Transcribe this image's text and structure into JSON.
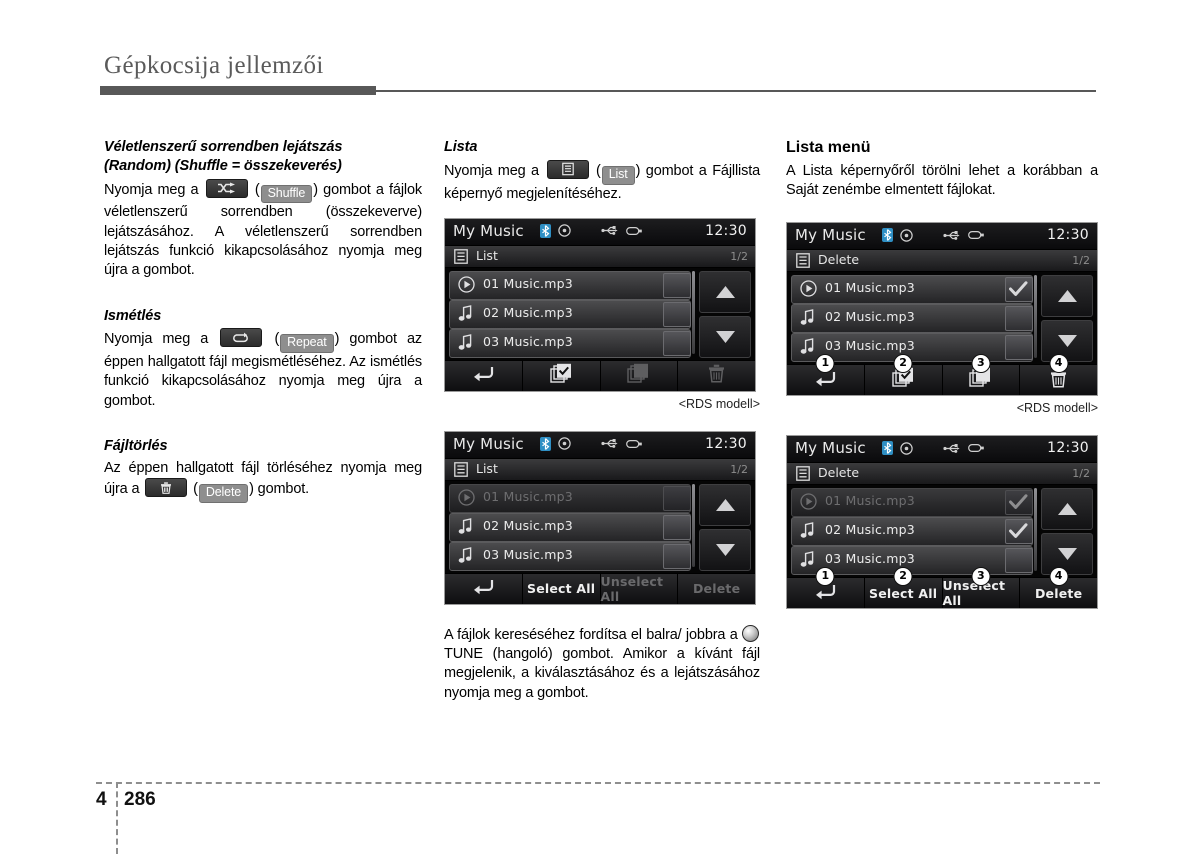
{
  "header": {
    "title": "Gépkocsija jellemzői"
  },
  "footer": {
    "chapter": "4",
    "page": "286"
  },
  "left_column": {
    "shuffle": {
      "heading_line1": "Véletlenszerű sorrendben lejátszás",
      "heading_line2": "(Random) (Shuffle = összekeverés)",
      "text_before": "Nyomja meg a",
      "icon_name": "shuffle-icon",
      "paren_open": "(",
      "button_label": "Shuffle",
      "paren_close": ")",
      "text_after": "gombot a fájlok véletlenszerű sorrendben (összekeverve) lejátszásához. A véletlenszerű sorrendben lejátszás funkció kikapcsolásához nyomja meg újra a gombot."
    },
    "repeat": {
      "heading": "Ismétlés",
      "text_before": "Nyomja meg a",
      "icon_name": "repeat-icon",
      "paren_open": "(",
      "button_label": "Repeat",
      "paren_close": ")",
      "text_after": "gombot az éppen hallgatott fájl megismétléséhez. Az ismétlés funkció kikapcsolásához nyomja meg újra a gombot."
    },
    "delete": {
      "heading": "Fájltörlés",
      "text_before": "Az éppen hallgatott fájl törléséhez nyomja meg újra a",
      "icon_name": "trash-icon",
      "paren_open": "(",
      "button_label": "Delete",
      "paren_close": ")",
      "text_after": "gombot."
    }
  },
  "mid_column": {
    "list": {
      "heading": "Lista",
      "text_before": "Nyomja meg a",
      "icon_name": "list-icon",
      "paren_open": "(",
      "button_label": "List",
      "paren_close": ")",
      "text_after": "gombot a Fájllista képernyő megjelenítéséhez."
    },
    "caption": "<RDS modell>",
    "tune_text_before": "A fájlok kereséséhez fordítsa el balra/ jobbra a",
    "tune_knob_name": "tune-knob-icon",
    "tune_text_after": "TUNE (hangoló) gombot. Amikor a kívánt fájl megjelenik, a kiválasztásához és a lejátszásához nyomja meg a gombot."
  },
  "right_column": {
    "heading": "Lista menü",
    "text": "A Lista képernyőről törölni lehet a korábban a Saját zenémbe elmentett fájlokat.",
    "caption": "<RDS modell>"
  },
  "devices": {
    "list_icons": {
      "title": "My Music",
      "clock": "12:30",
      "screen_label": "List",
      "page_indicator": "1/2",
      "status_icons": [
        "bluetooth-icon",
        "disc-icon",
        "usb-icon",
        "connector-icon"
      ],
      "rows": [
        {
          "label": "01 Music.mp3",
          "icon": "play-icon",
          "dim": false,
          "checked": false
        },
        {
          "label": "02 Music.mp3",
          "icon": "note-icon",
          "dim": false,
          "checked": false
        },
        {
          "label": "03 Music.mp3",
          "icon": "note-icon",
          "dim": false,
          "checked": false
        }
      ],
      "footer_buttons": [
        {
          "type": "icon",
          "icon": "back-arrow-icon",
          "label": "",
          "dim": false,
          "callout": ""
        },
        {
          "type": "icon",
          "icon": "select-all-checkbox-icon",
          "label": "",
          "dim": false,
          "callout": ""
        },
        {
          "type": "icon",
          "icon": "unselect-all-layers-icon",
          "label": "",
          "dim": true,
          "callout": ""
        },
        {
          "type": "icon",
          "icon": "trash-icon",
          "label": "",
          "dim": true,
          "callout": ""
        }
      ]
    },
    "list_text": {
      "title": "My Music",
      "clock": "12:30",
      "screen_label": "List",
      "page_indicator": "1/2",
      "status_icons": [
        "bluetooth-icon",
        "disc-icon",
        "usb-icon",
        "connector-icon"
      ],
      "rows": [
        {
          "label": "01 Music.mp3",
          "icon": "play-icon",
          "dim": true,
          "checked": false
        },
        {
          "label": "02 Music.mp3",
          "icon": "note-icon",
          "dim": false,
          "checked": false
        },
        {
          "label": "03 Music.mp3",
          "icon": "note-icon",
          "dim": false,
          "checked": false
        }
      ],
      "footer_buttons": [
        {
          "type": "icon",
          "icon": "back-arrow-icon",
          "label": "",
          "dim": false,
          "callout": ""
        },
        {
          "type": "text",
          "icon": "",
          "label": "Select All",
          "dim": false,
          "callout": ""
        },
        {
          "type": "text",
          "icon": "",
          "label": "Unselect All",
          "dim": true,
          "callout": ""
        },
        {
          "type": "text",
          "icon": "",
          "label": "Delete",
          "dim": true,
          "callout": ""
        }
      ]
    },
    "delete_icons": {
      "title": "My Music",
      "clock": "12:30",
      "screen_label": "Delete",
      "page_indicator": "1/2",
      "status_icons": [
        "bluetooth-icon",
        "disc-icon",
        "usb-icon",
        "connector-icon"
      ],
      "rows": [
        {
          "label": "01 Music.mp3",
          "icon": "play-icon",
          "dim": false,
          "checked": true
        },
        {
          "label": "02 Music.mp3",
          "icon": "note-icon",
          "dim": false,
          "checked": false
        },
        {
          "label": "03 Music.mp3",
          "icon": "note-icon",
          "dim": false,
          "checked": false
        }
      ],
      "footer_buttons": [
        {
          "type": "icon",
          "icon": "back-arrow-icon",
          "label": "",
          "dim": false,
          "callout": "1"
        },
        {
          "type": "icon",
          "icon": "select-all-checkbox-icon",
          "label": "",
          "dim": false,
          "callout": "2"
        },
        {
          "type": "icon",
          "icon": "unselect-all-layers-icon",
          "label": "",
          "dim": false,
          "callout": "3"
        },
        {
          "type": "icon",
          "icon": "trash-icon",
          "label": "",
          "dim": false,
          "callout": "4"
        }
      ]
    },
    "delete_text": {
      "title": "My Music",
      "clock": "12:30",
      "screen_label": "Delete",
      "page_indicator": "1/2",
      "status_icons": [
        "bluetooth-icon",
        "disc-icon",
        "usb-icon",
        "connector-icon"
      ],
      "rows": [
        {
          "label": "01 Music.mp3",
          "icon": "play-icon",
          "dim": true,
          "checked": true
        },
        {
          "label": "02 Music.mp3",
          "icon": "note-icon",
          "dim": false,
          "checked": true
        },
        {
          "label": "03 Music.mp3",
          "icon": "note-icon",
          "dim": false,
          "checked": false
        }
      ],
      "footer_buttons": [
        {
          "type": "icon",
          "icon": "back-arrow-icon",
          "label": "",
          "dim": false,
          "callout": "1"
        },
        {
          "type": "text",
          "icon": "",
          "label": "Select All",
          "dim": false,
          "callout": "2"
        },
        {
          "type": "text",
          "icon": "",
          "label": "Unselect All",
          "dim": false,
          "callout": "3"
        },
        {
          "type": "text",
          "icon": "",
          "label": "Delete",
          "dim": false,
          "callout": "4"
        }
      ]
    }
  },
  "colors": {
    "header_gray": "#585858",
    "chip_gray": "#8e8e8e",
    "bluetooth_blue": "#3aa7e0",
    "screen_black": "#050505"
  }
}
